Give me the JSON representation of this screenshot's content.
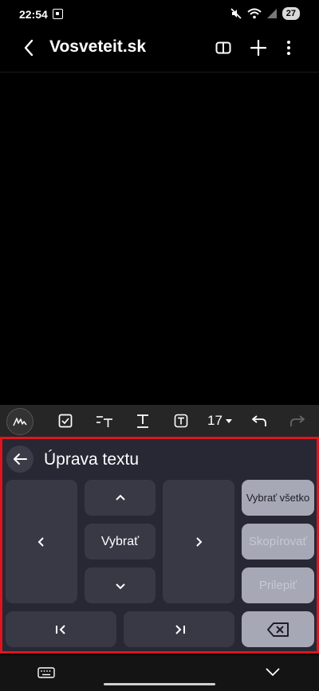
{
  "status_bar": {
    "time": "22:54",
    "battery": "27"
  },
  "app_bar": {
    "title": "Vosveteit.sk"
  },
  "toolbar": {
    "font_size": "17"
  },
  "edit_panel": {
    "title": "Úprava textu",
    "select_label": "Vybrať",
    "select_all_label": "Vybrať všetko",
    "copy_label": "Skopírovať",
    "paste_label": "Prilepiť"
  }
}
